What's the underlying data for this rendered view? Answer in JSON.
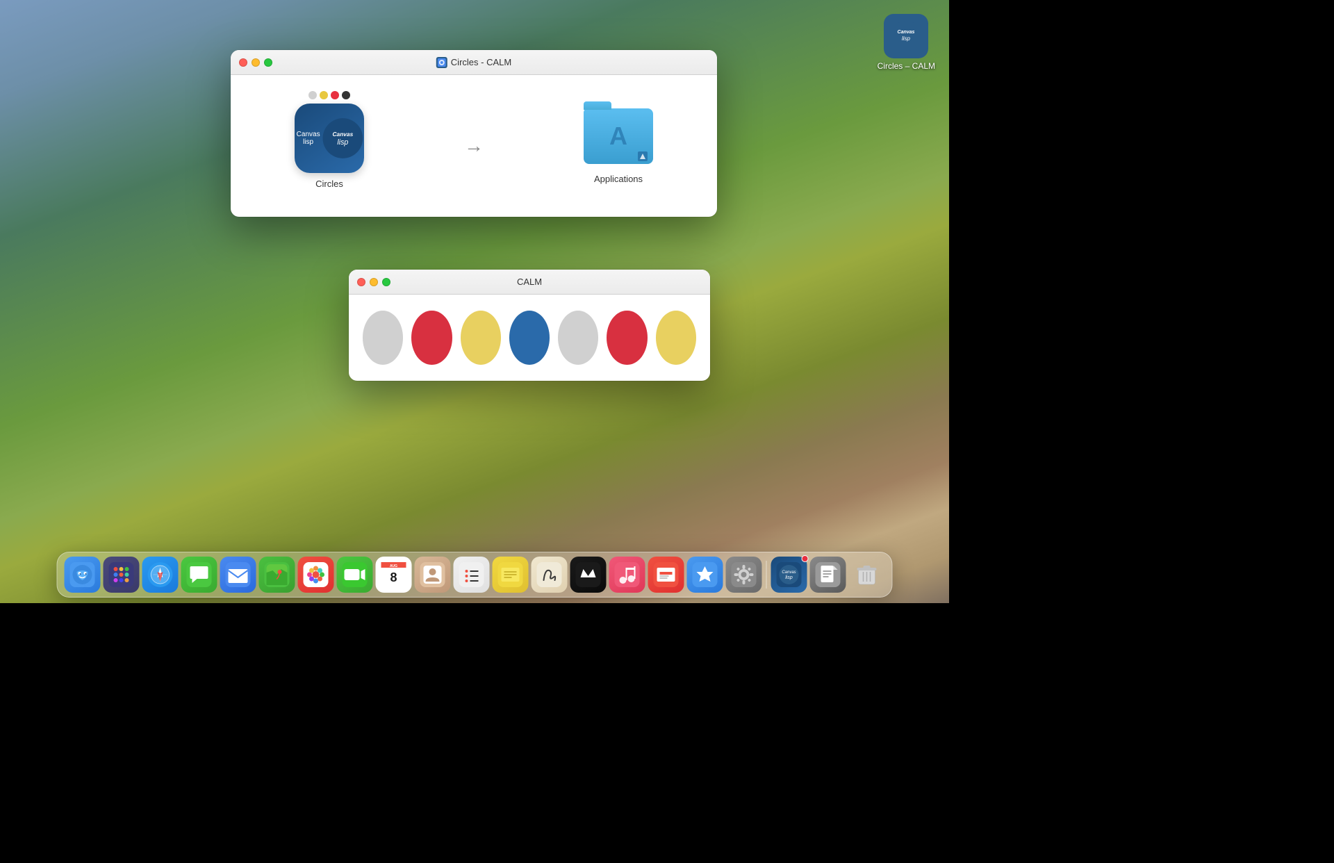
{
  "desktop": {
    "background_description": "macOS Sonoma vineyard landscape"
  },
  "desktop_icon": {
    "label": "Circles – CALM",
    "app_name": "Circles – CALM"
  },
  "installer_window": {
    "title": "Circles - CALM",
    "title_icon": "disk-image-icon",
    "circles_item": {
      "label": "Circles",
      "icon": "circles-app-icon"
    },
    "applications_item": {
      "label": "Applications",
      "icon": "applications-folder-icon"
    }
  },
  "calm_window": {
    "title": "CALM",
    "circles": [
      {
        "color": "#d0d0d0",
        "label": "gray-circle-1"
      },
      {
        "color": "#d83040",
        "label": "red-circle-1"
      },
      {
        "color": "#e8d060",
        "label": "yellow-circle-1"
      },
      {
        "color": "#2a6aaa",
        "label": "blue-circle"
      },
      {
        "color": "#d0d0d0",
        "label": "gray-circle-2"
      },
      {
        "color": "#d83040",
        "label": "red-circle-2"
      },
      {
        "color": "#e8d060",
        "label": "yellow-circle-2"
      }
    ]
  },
  "dock": {
    "items": [
      {
        "name": "finder",
        "label": "Finder",
        "icon_type": "finder"
      },
      {
        "name": "launchpad",
        "label": "Launchpad",
        "icon_type": "launchpad"
      },
      {
        "name": "safari",
        "label": "Safari",
        "icon_type": "safari"
      },
      {
        "name": "messages",
        "label": "Messages",
        "icon_type": "messages"
      },
      {
        "name": "mail",
        "label": "Mail",
        "icon_type": "mail"
      },
      {
        "name": "maps",
        "label": "Maps",
        "icon_type": "maps"
      },
      {
        "name": "photos",
        "label": "Photos",
        "icon_type": "photos"
      },
      {
        "name": "facetime",
        "label": "FaceTime",
        "icon_type": "facetime"
      },
      {
        "name": "calendar",
        "label": "Calendar Aug 8",
        "badge": "8",
        "icon_type": "calendar"
      },
      {
        "name": "contacts",
        "label": "Contacts",
        "icon_type": "contacts"
      },
      {
        "name": "reminders",
        "label": "Reminders",
        "icon_type": "reminders"
      },
      {
        "name": "notes",
        "label": "Notes",
        "icon_type": "notes"
      },
      {
        "name": "freeform",
        "label": "Freeform",
        "icon_type": "freeform"
      },
      {
        "name": "appletv",
        "label": "Apple TV",
        "icon_type": "appletv"
      },
      {
        "name": "music",
        "label": "Music",
        "icon_type": "music"
      },
      {
        "name": "news",
        "label": "News",
        "icon_type": "news"
      },
      {
        "name": "appstore",
        "label": "App Store",
        "icon_type": "appstore"
      },
      {
        "name": "syspref",
        "label": "System Preferences",
        "icon_type": "syspref"
      },
      {
        "name": "circles",
        "label": "Circles",
        "icon_type": "circles"
      },
      {
        "name": "quicklook",
        "label": "Quick Look",
        "icon_type": "quicklook"
      },
      {
        "name": "trash",
        "label": "Trash",
        "icon_type": "trash"
      }
    ]
  },
  "traffic_lights": {
    "close": "close-button",
    "minimize": "minimize-button",
    "maximize": "maximize-button"
  }
}
